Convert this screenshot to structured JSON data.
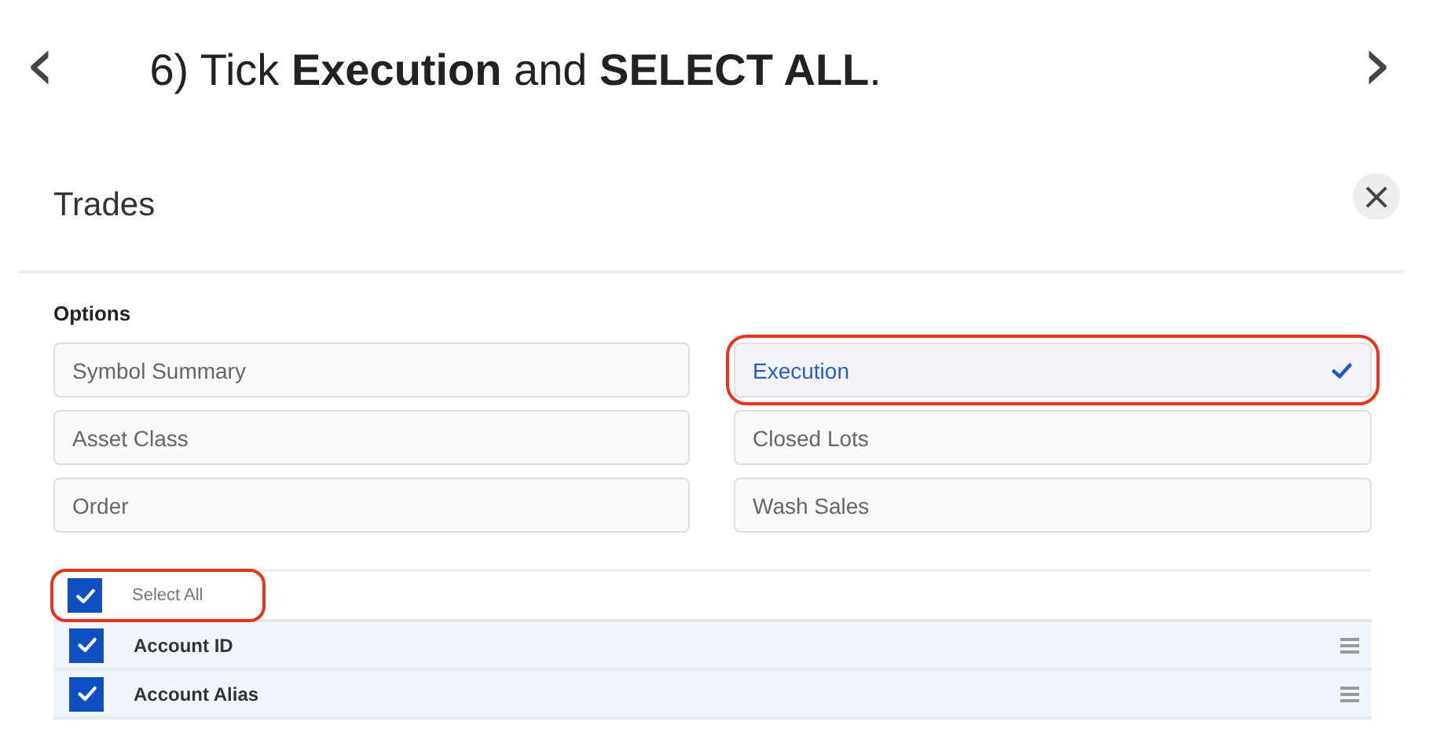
{
  "instruction": {
    "back": "‹",
    "text": "6) Tick **Execution** and **SELECT ALL**.",
    "next": "›"
  },
  "dialog": {
    "title": "Trades",
    "close": "×",
    "options_label": "Options",
    "options": [
      {
        "label": "Symbol Summary",
        "selected": false,
        "highlighted": false
      },
      {
        "label": "Execution",
        "selected": true,
        "highlighted": true
      },
      {
        "label": "Asset Class",
        "selected": false,
        "highlighted": false
      },
      {
        "label": "Closed Lots",
        "selected": false,
        "highlighted": false
      },
      {
        "label": "Order",
        "selected": false,
        "highlighted": false
      },
      {
        "label": "Wash Sales",
        "selected": false,
        "highlighted": false
      }
    ],
    "select_all": {
      "label": "Select All",
      "checked": true,
      "highlighted": true
    },
    "fields": [
      {
        "label": "Account ID",
        "checked": true
      },
      {
        "label": "Account Alias",
        "checked": true
      }
    ]
  }
}
